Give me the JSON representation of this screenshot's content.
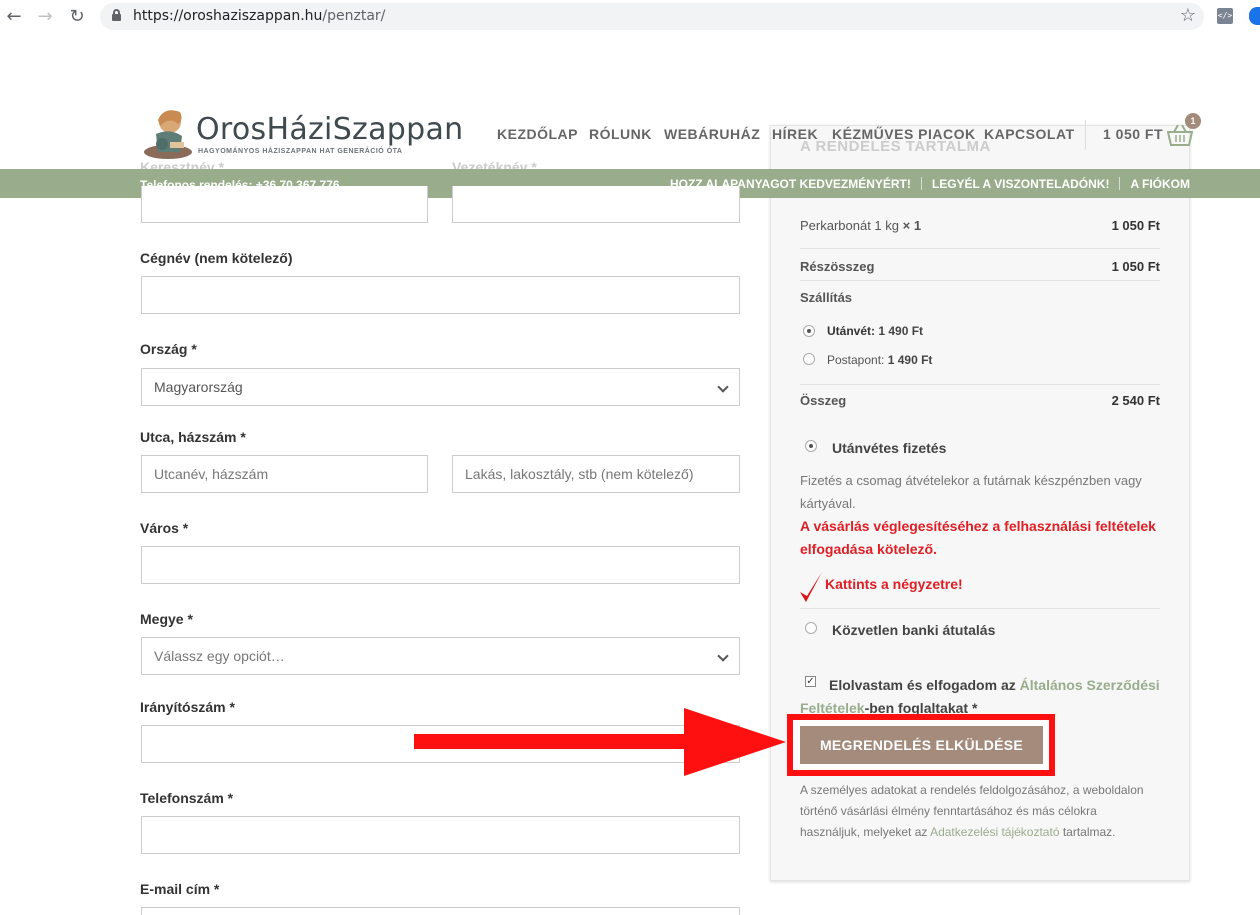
{
  "browser": {
    "back": "←",
    "forward": "→",
    "reload": "↻",
    "url_host": "https://oroshaziszappan.hu",
    "url_path": "/penztar/",
    "star": "☆",
    "ext_label": "</>"
  },
  "header": {
    "logo_name": "OrosHáziSzappan",
    "logo_tagline": "HAGYOMÁNYOS HÁZISZAPPAN HAT GENERÁCIÓ ÓTA",
    "nav": [
      "KEZDŐLAP",
      "RÓLUNK",
      "WEBÁRUHÁZ",
      "HÍREK",
      "KÉZMŰVES PIACOK",
      "KAPCSOLAT"
    ],
    "cart_total": "1 050 FT",
    "cart_count": "1"
  },
  "topbar": {
    "phone": "Telefonos rendelés: +36 70 367 776",
    "links": [
      "HOZZ ALAPANYAGOT KEDVEZMÉNYÉRT!",
      "LEGYÉL A VISZONTELADÓNK!",
      "A FIÓKOM"
    ]
  },
  "form": {
    "first_name_label": "Keresztnév *",
    "last_name_label": "Vezetéknév *",
    "company_label": "Cégnév (nem kötelező)",
    "country_label": "Ország *",
    "country_value": "Magyarország",
    "street_label": "Utca, házszám *",
    "street_placeholder": "Utcanév, házszám",
    "apartment_placeholder": "Lakás, lakosztály, stb (nem kötelező)",
    "city_label": "Város *",
    "county_label": "Megye *",
    "county_placeholder": "Válassz egy opciót…",
    "zip_label": "Irányítószám *",
    "phone_label": "Telefonszám *",
    "email_label": "E-mail cím *"
  },
  "order": {
    "title": "A RENDELÉS TARTALMA",
    "item_name": "Perkarbonát 1 kg",
    "item_qty": "× 1",
    "item_price": "1 050 Ft",
    "subtotal_label": "Részösszeg",
    "subtotal_value": "1 050 Ft",
    "shipping_label": "Szállítás",
    "shipping_options": [
      {
        "name": "Utánvét:",
        "price": "1 490 Ft",
        "selected": true
      },
      {
        "name": "Postapont:",
        "price": "1 490 Ft",
        "selected": false
      }
    ],
    "total_label": "Összeg",
    "total_value": "2 540 Ft",
    "payment_cod_label": "Utánvétes fizetés",
    "payment_cod_desc": "Fizetés a csomag átvételekor a futárnak készpénzben vagy kártyával.",
    "warning": "A vásárlás véglegesítéséhez a felhasználási feltételek elfogadása kötelező.",
    "click_note": "Kattints a négyzetre!",
    "payment_bank_label": "Közvetlen banki átutalás",
    "terms_prefix": "Elolvastam és elfogadom az ",
    "terms_link": "Általános Szerződési Feltételek",
    "terms_suffix": "-ben foglaltakat *",
    "checkbox_mark": "✓",
    "submit_label": "MEGRENDELÉS ELKÜLDÉSE",
    "privacy_prefix": "A személyes adatokat a rendelés feldolgozásához, a weboldalon történő vásárlási élmény fenntartásához és más célokra használjuk, melyeket az ",
    "privacy_link": "Adatkezelési tájékoztató",
    "privacy_suffix": " tartalmaz."
  },
  "colors": {
    "brand_green": "#99ad8c",
    "button_brown": "#a48b7c",
    "annotation_red": "#ff1010",
    "warning_red": "#e01e24"
  }
}
